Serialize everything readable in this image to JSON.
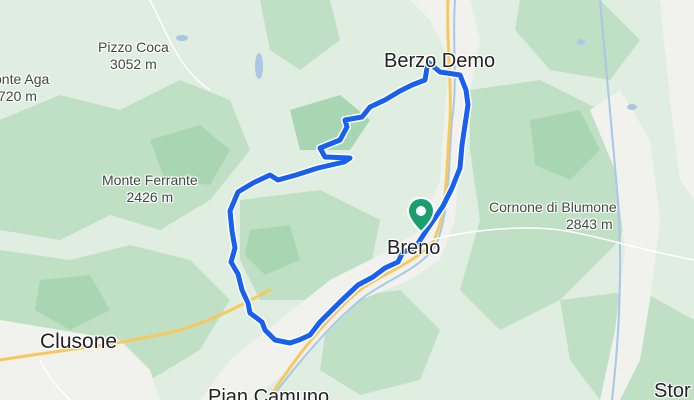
{
  "map": {
    "colors": {
      "terrain_light": "#dfeee0",
      "forest": "#bfe0c4",
      "forest_dark": "#a9d6b2",
      "valley": "#f1f2ee",
      "river": "#a9c7e6",
      "road": "#f6c95d",
      "road_minor": "#ffffff",
      "route": "#1860f0",
      "route_casing": "#ffffff",
      "marker": "#1b9e6e"
    },
    "icons": {
      "marker": "map-pin-icon"
    }
  },
  "labels": {
    "pizzo_coca": {
      "name": "Pizzo Coca",
      "elevation": "3052 m"
    },
    "monte_aga": {
      "name": "onte Aga",
      "elevation": "720 m"
    },
    "monte_ferrante": {
      "name": "Monte Ferrante",
      "elevation": "2426 m"
    },
    "cornone": {
      "name": "Cornone di Blumone",
      "elevation": "2843 m"
    },
    "berzo_demo": "Berzo Demo",
    "breno": "Breno",
    "clusone": "Clusone",
    "pian_camuno": "Pian Camuno",
    "stor": "Stor"
  }
}
